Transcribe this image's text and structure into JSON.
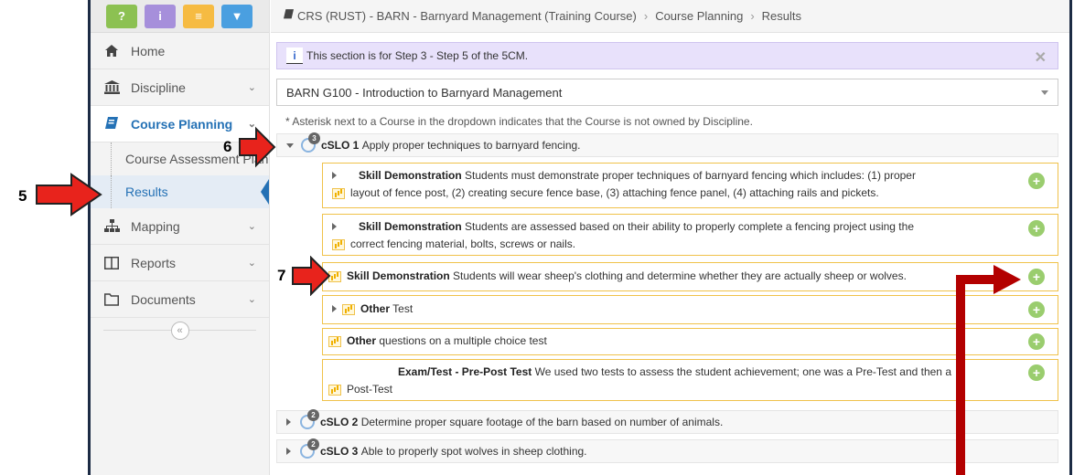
{
  "toolbar": {
    "buttons": [
      {
        "glyph": "?",
        "color": "#8cc152"
      },
      {
        "glyph": "i",
        "color": "#a68fdb"
      },
      {
        "glyph": "≡",
        "color": "#f6bb42"
      },
      {
        "glyph": "▼",
        "color": "#4a9fe0"
      }
    ]
  },
  "sidebar": {
    "items": [
      {
        "label": "Home",
        "icon": "home-icon"
      },
      {
        "label": "Discipline",
        "icon": "institution-icon"
      },
      {
        "label": "Course Planning",
        "icon": "book-icon"
      },
      {
        "label": "Mapping",
        "icon": "sitemap-icon"
      },
      {
        "label": "Reports",
        "icon": "columns-icon"
      },
      {
        "label": "Documents",
        "icon": "folder-icon"
      }
    ],
    "subitems": [
      "Course Assessment Plan",
      "Results"
    ],
    "collapse": "«"
  },
  "breadcrumb": {
    "course": "CRS (RUST) - BARN - Barnyard Management (Training Course)",
    "level2": "Course Planning",
    "level3": "Results"
  },
  "info": {
    "text": "This section is for Step 3 - Step 5 of the 5CM."
  },
  "select": {
    "value": "BARN G100 - Introduction to Barnyard Management"
  },
  "note": "* Asterisk next to a Course in the dropdown indicates that the Course is not owned by Discipline.",
  "clos": [
    {
      "code": "cSLO 1",
      "text": "Apply proper techniques to barnyard fencing.",
      "count": "3"
    },
    {
      "code": "cSLO 2",
      "text": "Determine proper square footage of the barn based on number of animals.",
      "count": "2"
    },
    {
      "code": "cSLO 3",
      "text": "Able to properly spot wolves in sheep clothing.",
      "count": "2"
    }
  ],
  "assessments": [
    {
      "type": "Skill Demonstration",
      "line1": "Students must demonstrate proper techniques of barnyard fencing which includes: (1) proper",
      "line2": "layout of fence post, (2) creating secure fence base, (3) attaching fence panel, (4) attaching rails and pickets."
    },
    {
      "type": "Skill Demonstration",
      "line1": "Students are assessed based on their ability to properly complete a fencing project using the",
      "line2": "correct fencing material, bolts, screws or nails."
    },
    {
      "type": "Skill Demonstration",
      "line1": "Students will wear sheep's clothing and determine whether they are actually sheep or wolves."
    },
    {
      "type": "Other",
      "line1": "Test"
    },
    {
      "type": "Other",
      "line1": "questions on a multiple choice test"
    },
    {
      "type": "Exam/Test - Pre-Post Test",
      "line1": "We used two tests to assess the student achievement; one was a Pre-Test and then a",
      "line2": "Post-Test"
    }
  ],
  "plus_glyph": "+",
  "close_glyph": "✕",
  "annotations": {
    "n5": "5",
    "n6": "6",
    "n7": "7",
    "arrow_color": "#b30000"
  }
}
